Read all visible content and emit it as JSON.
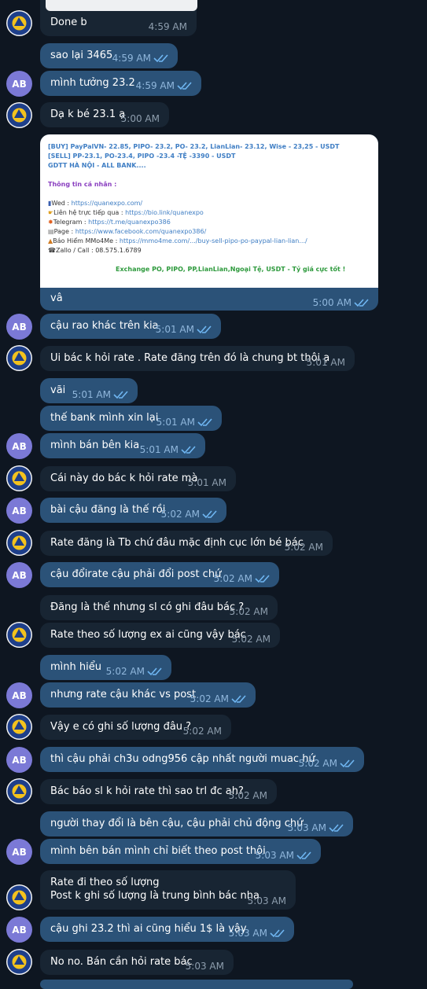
{
  "brand_colors": {
    "background": "#0e1621",
    "incoming": "#182533",
    "outgoing": "#2b5278",
    "avatar_ab": "#7b79d6"
  },
  "avatar_ab_initials": "AB",
  "messages": [
    {
      "text": "Done b",
      "time": "4:59 AM"
    },
    {
      "text": "sao lại 3465",
      "time": "4:59 AM"
    },
    {
      "text": "mình tưởng 23.2",
      "time": "4:59 AM"
    },
    {
      "text": "Dạ k bé 23.1 ạ",
      "time": "5:00 AM"
    },
    {
      "text": "vâ",
      "time": "5:00 AM"
    },
    {
      "text": "cậu rao khác trên kia",
      "time": "5:01 AM"
    },
    {
      "text": "Ui bác k hỏi rate . Rate đăng trên đó là chung bt thôi ạ",
      "time": "5:01 AM"
    },
    {
      "text": "vãi",
      "time": "5:01 AM"
    },
    {
      "text": "thế bank mình xin lại",
      "time": "5:01 AM"
    },
    {
      "text": "mình bán bên kia",
      "time": "5:01 AM"
    },
    {
      "text": "Cái này do bác k hỏi rate mà",
      "time": "5:01 AM"
    },
    {
      "text": "bài cậu đăng là thế rồi",
      "time": "5:02 AM"
    },
    {
      "text": "Rate đăng là Tb chứ đâu mặc định cục lớn bé bác",
      "time": "5:02 AM"
    },
    {
      "text": "cậu đổirate cậu phải đổi post chứ",
      "time": "5:02 AM"
    },
    {
      "text": "Đăng là thế nhưng sl có ghi đâu bác ?",
      "time": "5:02 AM"
    },
    {
      "text": "Rate theo số lượng ex ai cũng vậy bác",
      "time": "5:02 AM"
    },
    {
      "text": "mình hiểu",
      "time": "5:02 AM"
    },
    {
      "text": "nhưng rate cậu khác vs post",
      "time": "5:02 AM"
    },
    {
      "text": "Vậy e có ghi số lượng đâu ?",
      "time": "5:02 AM"
    },
    {
      "text": "thì cậu phải ch3u odng956 cập nhất người muac hứ",
      "time": "5:02 AM"
    },
    {
      "text": "Bác báo sl k hỏi rate thì sao trl đc ah?",
      "time": "5:02 AM"
    },
    {
      "text": "người thay đổi là bên cậu, cậu phải chủ động chứ",
      "time": "5:03 AM"
    },
    {
      "text": "mình bên bán mình chỉ biết theo post thôi",
      "time": "5:03 AM"
    },
    {
      "text": "Rate đi theo số lượng",
      "text2": "Post k ghi số lượng là trung bình bác nha",
      "time": "5:03 AM"
    },
    {
      "text": "cậu ghi 23.2 thì ai cũng hiểu 1$ là vậy",
      "time": "5:03 AM"
    },
    {
      "text": "No no. Bán cần hỏi rate bác",
      "time": "5:03 AM"
    }
  ],
  "preview": {
    "line1": "[BUY] PayPalVN- 22.85, PIPO- 23.2, PO- 23.2, LianLian- 23.12, Wise - 23,25 - USDT",
    "line2": "[SELL] PP-23.1, PO-23.4, PIPO -23.4 -TỆ -3390 - USDT",
    "line3": "GDTT HÀ NỘI - ALL BANK....",
    "info_title": "Thông tin cá nhân :",
    "wed_label": "Wed : ",
    "wed_url": "https://quanexpo.com/",
    "contact_label": "Liên hệ trực tiếp qua : ",
    "contact_url": "https://bio.link/quanexpo",
    "telegram_label": "Telegram : ",
    "telegram_url": "https://t.me/quanexpo386",
    "page_label": "Page : ",
    "page_url": "https://www.facebook.com/quanexpo386/",
    "mmo_label": "Báo Hiểm MMo4Me : ",
    "mmo_url": "https://mmo4me.com/.../buy-sell-pipo-po-paypal-lian-lian.../",
    "zalo": "Zallo / Call : 08.575.1.6789",
    "footer": "Exchange PO, PIPO, PP,LianLian,Ngoại Tệ, USDT - Tỷ giá cực tốt !"
  }
}
